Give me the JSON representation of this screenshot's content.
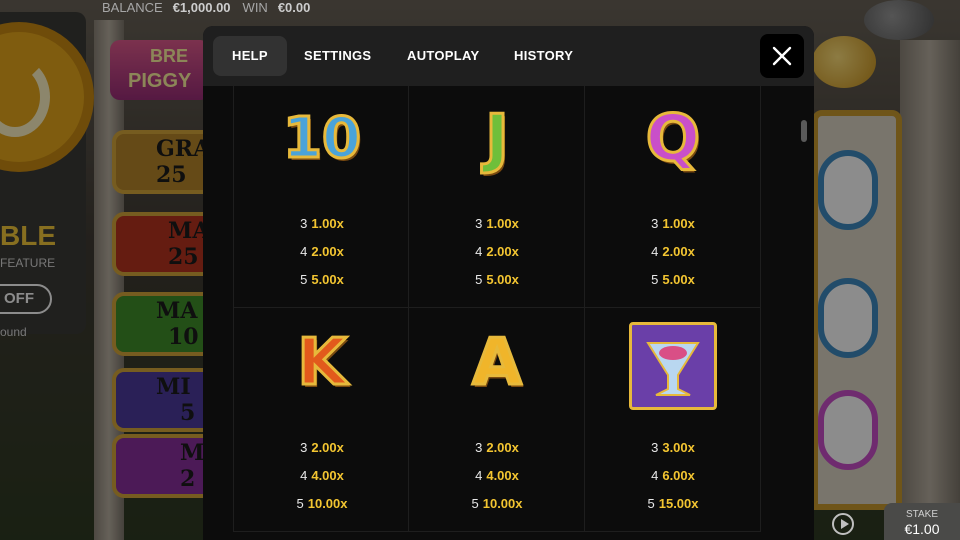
{
  "top_bar": {
    "balance_label": "BALANCE",
    "balance_value": "€1,000.00",
    "win_label": "WIN",
    "win_value": "€0.00"
  },
  "feature_panel": {
    "title": "BLE",
    "subtitle": "FEATURE",
    "toggle": "OFF",
    "round_text": "ound"
  },
  "jackpots": [
    {
      "name": "GRA",
      "value": "25"
    },
    {
      "name": "MA",
      "value": "25"
    },
    {
      "name": "MA",
      "value": "10"
    },
    {
      "name": "MI",
      "value": "5"
    },
    {
      "name": "M",
      "value": "2"
    }
  ],
  "logo": {
    "line1": "BRE",
    "line2": "PIGGY"
  },
  "modal": {
    "tabs": [
      {
        "label": "HELP",
        "active": true
      },
      {
        "label": "SETTINGS",
        "active": false
      },
      {
        "label": "AUTOPLAY",
        "active": false
      },
      {
        "label": "HISTORY",
        "active": false
      }
    ],
    "close_icon": "close-icon"
  },
  "paytable": [
    {
      "symbol": "10",
      "icon": "ten-symbol-icon",
      "color": "#4aa3d9",
      "pays": [
        {
          "count": "3",
          "mult": "1.00x"
        },
        {
          "count": "4",
          "mult": "2.00x"
        },
        {
          "count": "5",
          "mult": "5.00x"
        }
      ]
    },
    {
      "symbol": "J",
      "icon": "jack-symbol-icon",
      "color": "#6fbf3a",
      "pays": [
        {
          "count": "3",
          "mult": "1.00x"
        },
        {
          "count": "4",
          "mult": "2.00x"
        },
        {
          "count": "5",
          "mult": "5.00x"
        }
      ]
    },
    {
      "symbol": "Q",
      "icon": "queen-symbol-icon",
      "color": "#c94fc9",
      "pays": [
        {
          "count": "3",
          "mult": "1.00x"
        },
        {
          "count": "4",
          "mult": "2.00x"
        },
        {
          "count": "5",
          "mult": "5.00x"
        }
      ]
    },
    {
      "symbol": "K",
      "icon": "king-symbol-icon",
      "color": "#e25a1c",
      "pays": [
        {
          "count": "3",
          "mult": "2.00x"
        },
        {
          "count": "4",
          "mult": "4.00x"
        },
        {
          "count": "5",
          "mult": "10.00x"
        }
      ]
    },
    {
      "symbol": "A",
      "icon": "ace-symbol-icon",
      "color": "#f0b52a",
      "pays": [
        {
          "count": "3",
          "mult": "2.00x"
        },
        {
          "count": "4",
          "mult": "4.00x"
        },
        {
          "count": "5",
          "mult": "10.00x"
        }
      ]
    },
    {
      "symbol": "",
      "icon": "cocktail-glass-icon",
      "color": "#6a3fa8",
      "pays": [
        {
          "count": "3",
          "mult": "3.00x"
        },
        {
          "count": "4",
          "mult": "6.00x"
        },
        {
          "count": "5",
          "mult": "15.00x"
        }
      ]
    }
  ],
  "stake": {
    "label": "STAKE",
    "value": "€1.00"
  }
}
